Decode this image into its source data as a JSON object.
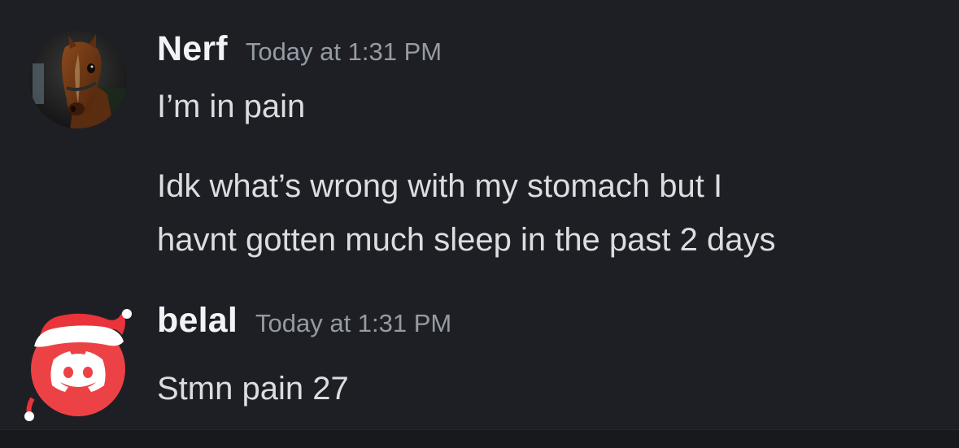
{
  "messages": [
    {
      "username": "Nerf",
      "timestamp": "Today at 1:31 PM",
      "avatar_icon": "horse-avatar-icon",
      "lines": [
        "I’m in pain",
        "Idk what’s wrong with my stomach but I",
        "havnt gotten much sleep in the past 2 days"
      ]
    },
    {
      "username": "belal",
      "timestamp": "Today at 1:31 PM",
      "avatar_icon": "discord-santa-hat-avatar-icon",
      "lines": [
        "Stmn pain 27"
      ]
    }
  ],
  "colors": {
    "background": "#1e1f24",
    "username": "#f2f3f5",
    "timestamp": "#949ba4",
    "message_text": "#dbdee1",
    "discord_red": "#ed4245",
    "santa_hat_red": "#e8343a"
  }
}
